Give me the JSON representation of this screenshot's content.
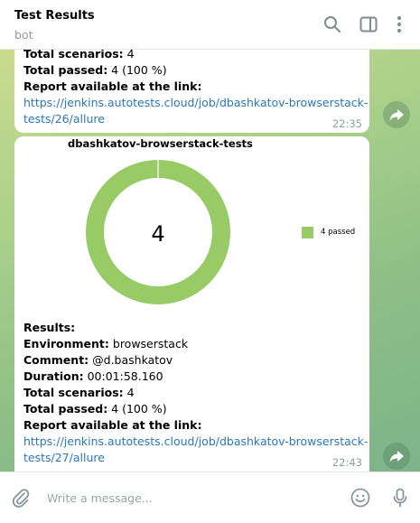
{
  "header": {
    "title": "Test Results",
    "subtitle": "bot"
  },
  "messages": [
    {
      "lines": [
        {
          "label": "Total scenarios:",
          "value": " 4"
        },
        {
          "label": "Total passed:",
          "value": " 4 (100 %)"
        },
        {
          "label": "Report available at the link:",
          "value": ""
        }
      ],
      "link_line1": "https://jenkins.autotests.cloud/job/dbashkatov-browserstack-",
      "link_line2": "tests/26/allure",
      "time": "22:35"
    },
    {
      "chart_title": "dbashkatov-browserstack-tests",
      "lines": [
        {
          "label": "Results:",
          "value": ""
        },
        {
          "label": "Environment:",
          "value": " browserstack"
        },
        {
          "label": "Comment:",
          "value": " @d.bashkatov"
        },
        {
          "label": "Duration:",
          "value": " 00:01:58.160"
        },
        {
          "label": "Total scenarios:",
          "value": " 4"
        },
        {
          "label": "Total passed:",
          "value": " 4 (100 %)"
        },
        {
          "label": "Report available at the link:",
          "value": ""
        }
      ],
      "link_line1": "https://jenkins.autotests.cloud/job/dbashkatov-browserstack-",
      "link_line2": "tests/27/allure",
      "time": "22:43"
    }
  ],
  "chart_data": {
    "type": "pie",
    "title": "dbashkatov-browserstack-tests",
    "center_label": "4",
    "slices": [
      {
        "name": "passed",
        "value": 4,
        "color": "#98cb65"
      }
    ],
    "legend": [
      "4 passed"
    ],
    "legend_position": "right"
  },
  "input": {
    "placeholder": "Write a message..."
  },
  "colors": {
    "accent": "#98cb65",
    "link": "#2a78b8",
    "time": "#8d9ea8"
  },
  "icons": [
    "search-icon",
    "sidebar-icon",
    "more-icon",
    "forward-icon",
    "attach-icon",
    "emoji-icon",
    "microphone-icon"
  ]
}
